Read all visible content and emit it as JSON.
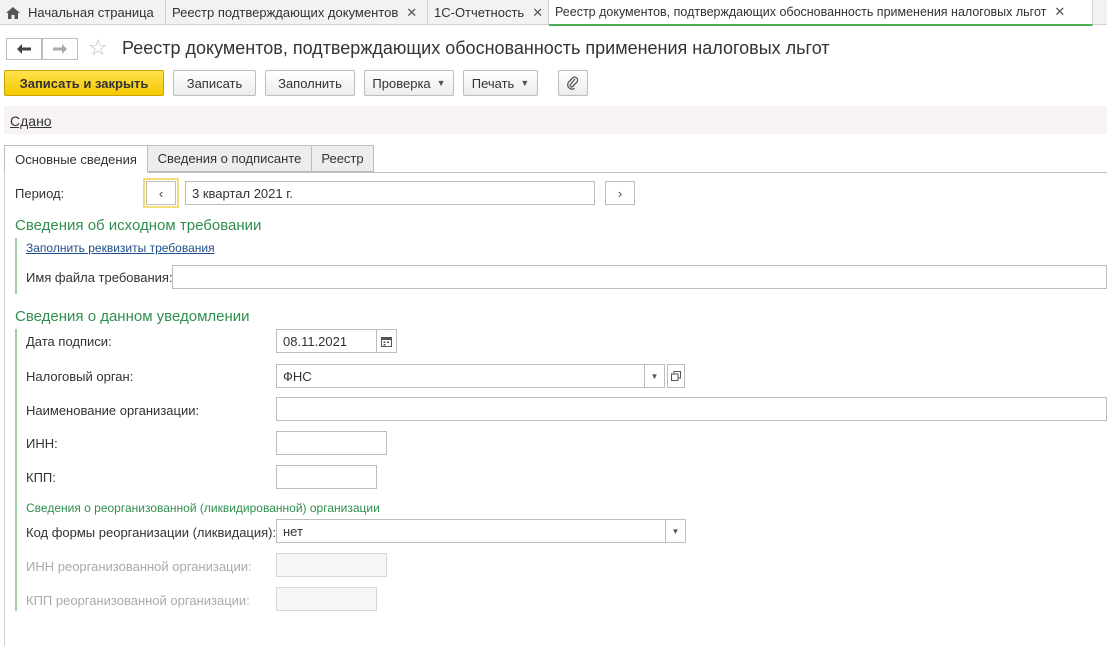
{
  "tabs": [
    {
      "label": "Начальная страница",
      "has_home_icon": true
    },
    {
      "label": "Реестр подтверждающих документов",
      "closable": true
    },
    {
      "label": "1С-Отчетность",
      "closable": true
    },
    {
      "label": "Реестр документов, подтверждающих обоснованность применения налоговых льгот",
      "closable": true,
      "active": true
    }
  ],
  "header": {
    "title": "Реестр документов, подтверждающих обоснованность применения налоговых льгот"
  },
  "toolbar": {
    "save_close_label": "Записать и закрыть",
    "save_label": "Записать",
    "fill_label": "Заполнить",
    "check_label": "Проверка",
    "print_label": "Печать"
  },
  "status": {
    "link_label": "Сдано"
  },
  "form_tabs": [
    {
      "label": "Основные сведения",
      "active": true
    },
    {
      "label": "Сведения о подписанте"
    },
    {
      "label": "Реестр"
    }
  ],
  "period": {
    "label": "Период:",
    "value": "3 квартал 2021 г.",
    "prev": "‹",
    "next": "›"
  },
  "requirement": {
    "section_title": "Сведения об исходном требовании",
    "fill_link": "Заполнить реквизиты требования",
    "filename_label": "Имя файла требования:",
    "filename_value": ""
  },
  "notice": {
    "section_title": "Сведения о данном уведомлении",
    "sign_date_label": "Дата подписи:",
    "sign_date_value": "08.11.2021",
    "tax_authority_label": "Налоговый орган:",
    "tax_authority_value": "ФНС",
    "org_name_label": "Наименование организации:",
    "org_name_value": "",
    "inn_label": "ИНН:",
    "inn_value": "",
    "kpp_label": "КПП:",
    "kpp_value": ""
  },
  "reorg": {
    "subsection_title": "Сведения о реорганизованной (ликвидированной) организации",
    "code_label": "Код формы реорганизации (ликвидация):",
    "code_value": "нет",
    "inn_label": "ИНН реорганизованной организации:",
    "kpp_label": "КПП реорганизованной организации:"
  },
  "colors": {
    "accent_green": "#2f8f4e",
    "primary_yellow": "#f5c800",
    "link_blue": "#1f4e8a"
  }
}
